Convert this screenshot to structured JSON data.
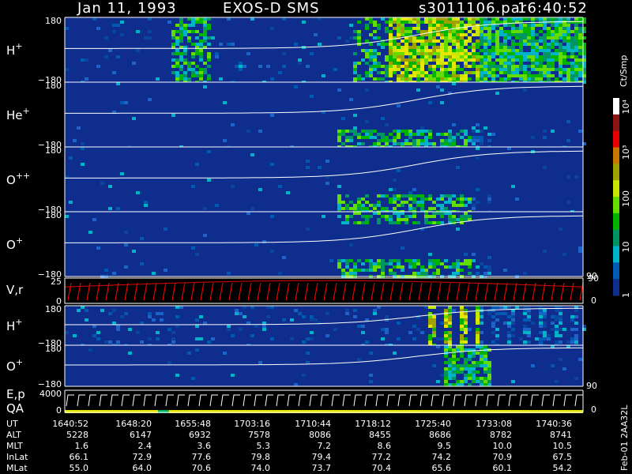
{
  "header": {
    "date": "Jan 11, 1993",
    "instrument": "EXOS-D SMS",
    "file": "s3011106.par",
    "time": "16:40:52"
  },
  "panels": [
    {
      "label": "H",
      "sup": "+",
      "top": "180",
      "bottom": "−180",
      "theme": "dense"
    },
    {
      "label": "He",
      "sup": "+",
      "top": "180",
      "bottom": "−180",
      "theme": "sparse"
    },
    {
      "label": "O",
      "sup": "++",
      "top": "180",
      "bottom": "−180",
      "theme": "sparse"
    },
    {
      "label": "O",
      "sup": "+",
      "top": "180",
      "bottom": "−180",
      "theme": "sparse",
      "right_tick": "90"
    },
    {
      "label": "V,r",
      "sup": "",
      "top": "25",
      "bottom": "0",
      "theme": "vr",
      "right_top": "90",
      "right_bottom": "0"
    },
    {
      "label": "H",
      "sup": "+",
      "top": "180",
      "bottom": "−180",
      "theme": "stripes"
    },
    {
      "label": "O",
      "sup": "+",
      "top": "180",
      "bottom": "−180",
      "theme": "late",
      "right_tick": "90"
    },
    {
      "label": "E,p",
      "label2": "QA",
      "top": "4000",
      "bottom": "0",
      "theme": "ep",
      "right_bottom": "0"
    }
  ],
  "colorbar": {
    "unit": "Ct/Smp",
    "ticks": [
      "10⁴",
      "10³",
      "100",
      "10",
      "1"
    ],
    "colors": [
      "#ffffff",
      "#8c1414",
      "#e60000",
      "#c87800",
      "#a0a000",
      "#c8e600",
      "#64dc00",
      "#00b400",
      "#009664",
      "#00b4c8",
      "#005ab4",
      "#0f2d8c"
    ]
  },
  "table": {
    "rows": [
      {
        "label": "UT",
        "values": [
          "1640:52",
          "1648:20",
          "1655:48",
          "1703:16",
          "1710:44",
          "1718:12",
          "1725:40",
          "1733:08",
          "1740:36"
        ]
      },
      {
        "label": "ALT",
        "values": [
          "5228",
          "6147",
          "6932",
          "7578",
          "8086",
          "8455",
          "8686",
          "8782",
          "8741"
        ]
      },
      {
        "label": "MLT",
        "values": [
          "1.6",
          "2.4",
          "3.6",
          "5.3",
          "7.2",
          "8.6",
          "9.5",
          "10.0",
          "10.5"
        ]
      },
      {
        "label": "InLat",
        "values": [
          "66.1",
          "72.9",
          "77.6",
          "79.8",
          "79.4",
          "77.2",
          "74.2",
          "70.9",
          "67.5"
        ]
      },
      {
        "label": "MLat",
        "values": [
          "55.0",
          "64.0",
          "70.6",
          "74.0",
          "73.7",
          "70.4",
          "65.6",
          "60.1",
          "54.2"
        ]
      }
    ]
  },
  "footer_id": "Feb-01 2AA32L",
  "chart_data": {
    "type": "heatmap",
    "title": "Jan 11, 1993   EXOS-D SMS",
    "x_ticks": [
      "1640:52",
      "1648:20",
      "1655:48",
      "1703:16",
      "1710:44",
      "1718:12",
      "1725:40",
      "1733:08",
      "1740:36"
    ],
    "series": [
      {
        "name": "H+",
        "ylim": [
          -180,
          180
        ]
      },
      {
        "name": "He+",
        "ylim": [
          -180,
          180
        ]
      },
      {
        "name": "O++",
        "ylim": [
          -180,
          180
        ]
      },
      {
        "name": "O+",
        "ylim": [
          -180,
          180
        ]
      },
      {
        "name": "V,r",
        "ylim": [
          0,
          25
        ]
      },
      {
        "name": "H+",
        "ylim": [
          -180,
          180
        ]
      },
      {
        "name": "O+",
        "ylim": [
          -180,
          180
        ]
      },
      {
        "name": "E,p",
        "ylim": [
          0,
          4000
        ]
      }
    ],
    "colorbar_unit": "Ct/Smp",
    "colorbar_ticks": [
      "1",
      "10",
      "100",
      "10³",
      "10⁴"
    ]
  }
}
